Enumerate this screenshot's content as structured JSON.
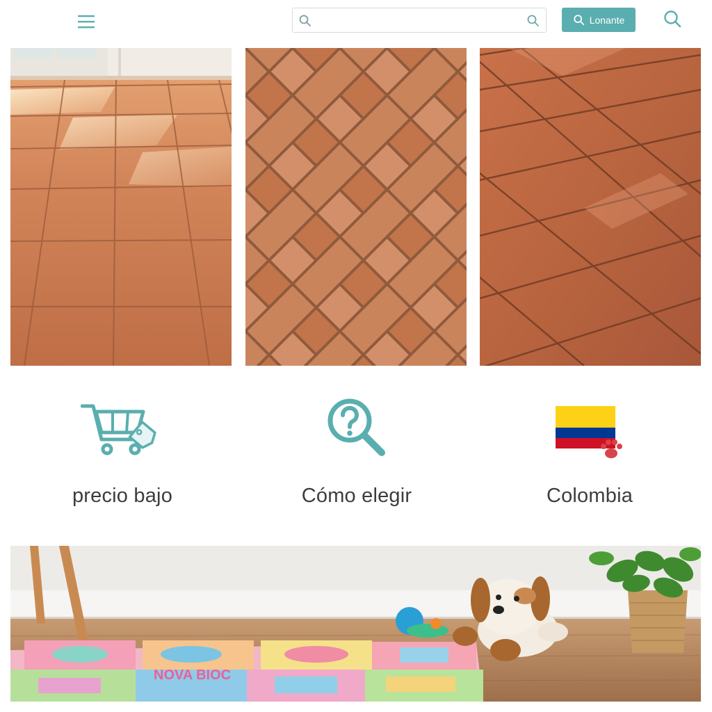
{
  "header": {
    "search": {
      "value": "",
      "placeholder": ""
    },
    "cta_label": "Lonante",
    "icons": {
      "menu": "hamburger-menu-icon",
      "search": "search-icon"
    }
  },
  "tiles": [
    {
      "name": "terracotta-square-tiles-photo"
    },
    {
      "name": "herringbone-brick-floor-photo"
    },
    {
      "name": "glossy-rectangular-tile-floor-photo"
    }
  ],
  "features": [
    {
      "label": "precio bajo",
      "icon": "shopping-cart-tag-icon"
    },
    {
      "label": "Cómo elegir",
      "icon": "question-magnifier-icon"
    },
    {
      "label": "Colombia",
      "icon": "colombia-flag-paw-icon"
    }
  ],
  "banner": {
    "mat_text": "NOVA BIOC",
    "description": "kids-room-foam-play-mat-photo"
  },
  "colors": {
    "accent": "#5aaeaf",
    "terracotta": "#c8744a",
    "flag_yellow": "#fcd116",
    "flag_blue": "#003893",
    "flag_red": "#ce1126",
    "paw_red": "#d9434a"
  }
}
